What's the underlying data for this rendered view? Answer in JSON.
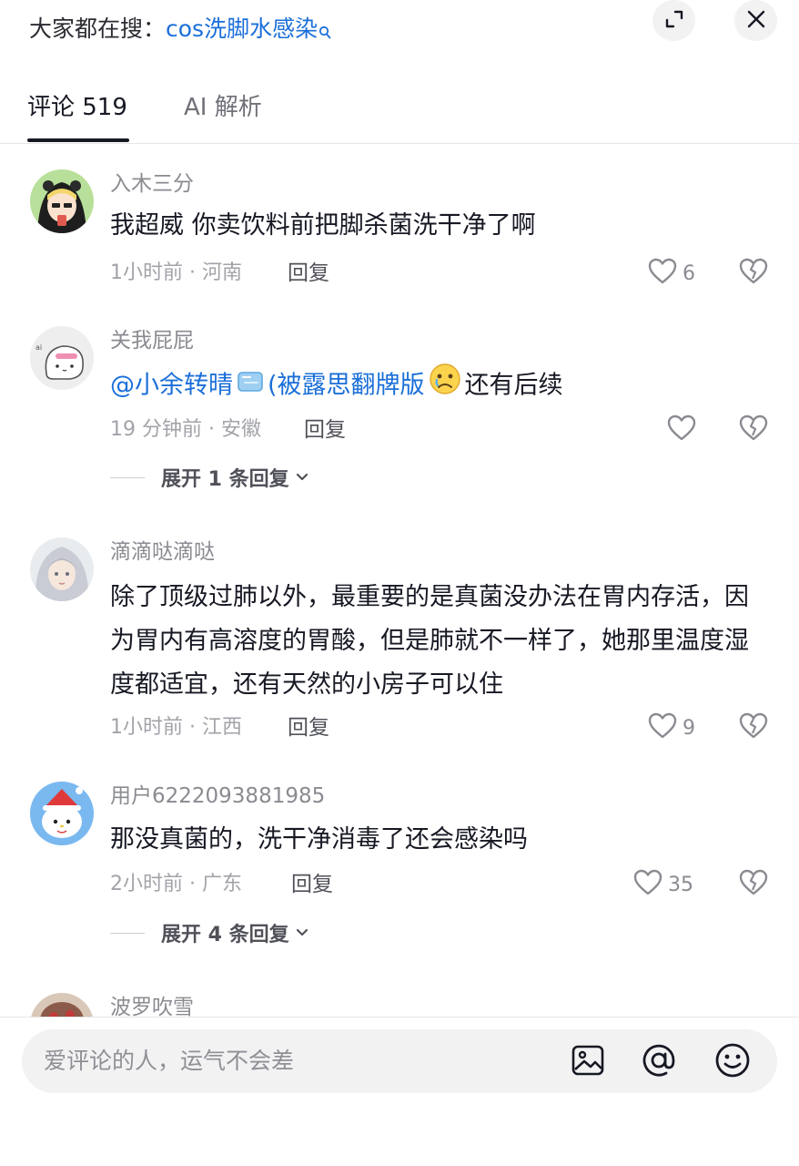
{
  "search_bar": {
    "prefix": "大家都在搜：",
    "query": "cos洗脚水感染",
    "icon": "search-icon"
  },
  "header_buttons": {
    "expand_icon": "expand-icon",
    "close_icon": "close-icon"
  },
  "tabs": [
    {
      "label": "评论 519",
      "active": true
    },
    {
      "label": "AI 解析",
      "active": false
    }
  ],
  "comments": [
    {
      "username": "入木三分",
      "text": "我超威 你卖饮料前把脚杀菌洗干净了啊",
      "time_location": "1小时前 · 河南",
      "reply_label": "回复",
      "likes": "6"
    },
    {
      "username": "关我屁屁",
      "mention": "@小余转晴",
      "mention_suffix": "(被露思翻牌版",
      "text_after_emoji": "还有后续",
      "time_location": "19 分钟前 · 安徽",
      "reply_label": "回复",
      "likes": "",
      "expand_label": "展开 1 条回复"
    },
    {
      "username": "滴滴哒滴哒",
      "text": "除了顶级过肺以外，最重要的是真菌没办法在胃内存活，因为胃内有高溶度的胃酸，但是肺就不一样了，她那里温度湿度都适宜，还有天然的小房子可以住",
      "time_location": "1小时前 · 江西",
      "reply_label": "回复",
      "likes": "9"
    },
    {
      "username": "用户6222093881985",
      "text": "那没真菌的，洗干净消毒了还会感染吗",
      "time_location": "2小时前 · 广东",
      "reply_label": "回复",
      "likes": "35",
      "expand_label": "展开 4 条回复"
    },
    {
      "username": "波罗吹雪"
    }
  ],
  "input_bar": {
    "placeholder": "爱评论的人，运气不会差",
    "icons": [
      "image-icon",
      "at-icon",
      "emoji-icon"
    ]
  },
  "colors": {
    "link": "#1b6fd9",
    "text": "#161823",
    "secondary": "#8a8b91",
    "input_bg": "#f2f2f3"
  }
}
